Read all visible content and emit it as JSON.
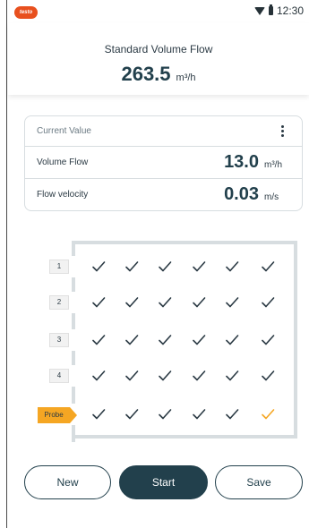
{
  "status_bar": {
    "app_logo": "testo",
    "time": "12:30",
    "icons": [
      "wifi-icon",
      "battery-icon"
    ]
  },
  "header": {
    "title": "Standard Volume Flow",
    "value": "263.5",
    "unit": "m³/h"
  },
  "card": {
    "title": "Current Value",
    "menu_icon": "kebab-menu-icon",
    "rows": [
      {
        "label": "Volume Flow",
        "value": "13.0",
        "unit": "m³/h"
      },
      {
        "label": "Flow velocity",
        "value": "0.03",
        "unit": "m/s"
      }
    ]
  },
  "grid": {
    "row_labels": [
      "1",
      "2",
      "3",
      "4"
    ],
    "probe_label": "Probe",
    "columns": 6,
    "rows": 5,
    "check_color": "#2b3a44",
    "active_check_color": "#f5a623",
    "active_cell": {
      "row": 5,
      "column": 6
    }
  },
  "buttons": {
    "new": "New",
    "start": "Start",
    "save": "Save"
  },
  "colors": {
    "primary": "#22404c",
    "accent": "#f5a623",
    "brand": "#e8501e",
    "border": "#d7dde0"
  }
}
